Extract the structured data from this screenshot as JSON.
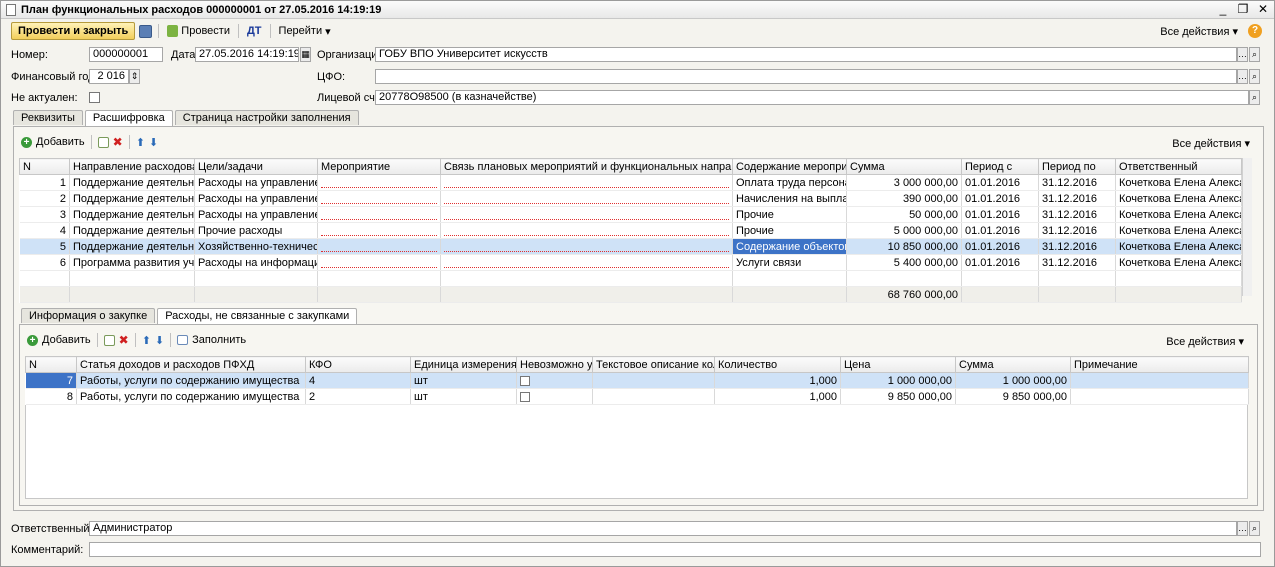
{
  "window": {
    "title": "План функциональных расходов 000000001 от 27.05.2016 14:19:19"
  },
  "toolbar": {
    "post_close": "Провести и закрыть",
    "post": "Провести",
    "goto": "Перейти",
    "all_actions": "Все действия"
  },
  "header": {
    "number_label": "Номер:",
    "number": "000000001",
    "date_label": "Дата:",
    "date": "27.05.2016 14:19:19",
    "org_label": "Организация:",
    "org": "ГОБУ ВПО Университет искусств",
    "finyear_label": "Финансовый год:",
    "finyear": "2 016",
    "cfo_label": "ЦФО:",
    "cfo": "",
    "inactive_label": "Не актуален:",
    "account_label": "Лицевой счет:",
    "account": "20778О98500 (в казначействе)"
  },
  "tabs": [
    "Реквизиты",
    "Расшифровка",
    "Страница настройки заполнения"
  ],
  "grid1": {
    "add": "Добавить",
    "all_actions": "Все действия",
    "columns": [
      "N",
      "Направление расходования",
      "Цели/задачи",
      "Мероприятие",
      "Связь плановых мероприятий и функциональных направлений с пок...",
      "Содержание мероприятия",
      "Сумма",
      "Период с",
      "Период по",
      "Ответственный"
    ],
    "rows": [
      [
        "1",
        "Поддержание деятельност...",
        "Расходы на управление пе...",
        "",
        "",
        "Оплата труда персонала",
        "3 000 000,00",
        "01.01.2016",
        "31.12.2016",
        "Кочеткова Елена Александ..."
      ],
      [
        "2",
        "Поддержание деятельност...",
        "Расходы на управление пе...",
        "",
        "",
        "Начисления на выплаты...",
        "390 000,00",
        "01.01.2016",
        "31.12.2016",
        "Кочеткова Елена Александ..."
      ],
      [
        "3",
        "Поддержание деятельност...",
        "Расходы на управление пе...",
        "",
        "",
        "Прочие",
        "50 000,00",
        "01.01.2016",
        "31.12.2016",
        "Кочеткова Елена Александ..."
      ],
      [
        "4",
        "Поддержание деятельност...",
        "Прочие расходы",
        "",
        "",
        "Прочие",
        "5 000 000,00",
        "01.01.2016",
        "31.12.2016",
        "Кочеткова Елена Александ..."
      ],
      [
        "5",
        "Поддержание деятельност...",
        "Хозяйственно-технические...",
        "",
        "",
        "Содержание объектов н...",
        "10 850 000,00",
        "01.01.2016",
        "31.12.2016",
        "Кочеткова Елена Александ..."
      ],
      [
        "6",
        "Программа развития учре...",
        "Расходы на информационн...",
        "",
        "",
        "Услуги связи",
        "5 400 000,00",
        "01.01.2016",
        "31.12.2016",
        "Кочеткова Елена Александ..."
      ]
    ],
    "total": "68 760 000,00"
  },
  "subtabs": [
    "Информация о закупке",
    "Расходы, не связанные с закупками"
  ],
  "grid2": {
    "add": "Добавить",
    "fill": "Заполнить",
    "all_actions": "Все действия",
    "columns": [
      "N",
      "Статья доходов и расходов ПФХД",
      "КФО",
      "Единица измерения",
      "Невозможно у...",
      "Текстовое описание коли...",
      "Количество",
      "Цена",
      "Сумма",
      "Примечание"
    ],
    "rows": [
      [
        "7",
        "Работы, услуги по содержанию имущества",
        "4",
        "шт",
        "",
        "",
        "1,000",
        "1 000 000,00",
        "1 000 000,00",
        ""
      ],
      [
        "8",
        "Работы, услуги по содержанию имущества",
        "2",
        "шт",
        "",
        "",
        "1,000",
        "9 850 000,00",
        "9 850 000,00",
        ""
      ]
    ]
  },
  "footer": {
    "resp_label": "Ответственный:",
    "resp": "Администратор",
    "comment_label": "Комментарий:",
    "comment": ""
  }
}
